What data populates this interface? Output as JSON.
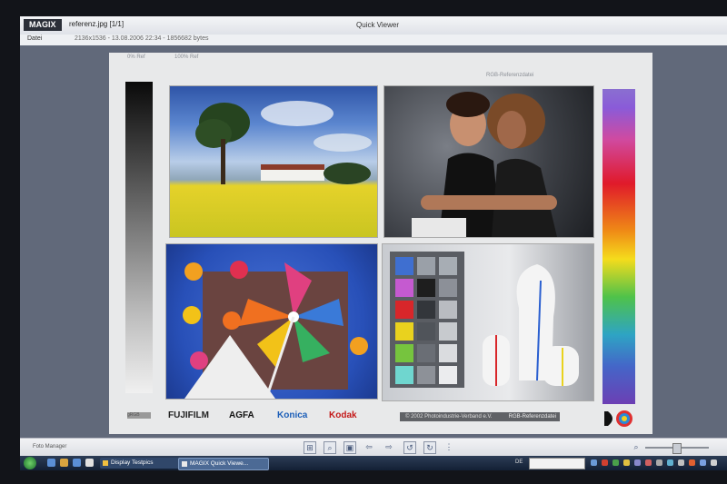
{
  "window": {
    "logo": "MAGIX",
    "filename": "referenz.jpg [1/1]",
    "app_title": "Quick Viewer",
    "menu": [
      "Datei"
    ],
    "file_info": "2136x1536  -  13.08.2006 22:34  -  1856682 bytes"
  },
  "chart_text": {
    "top_left_1": "0% Ref",
    "top_left_2": "100% Ref",
    "top_right": "RGB-Referenzdatei",
    "gray_label": "gRGB",
    "referenz_left": "© 2002 Photoindustrie-Verband e.V.",
    "referenz_right": "RGB-Referenzdatei"
  },
  "brands": {
    "fujifilm": "FUJIFILM",
    "agfa": "AGFA",
    "konica": "Konica",
    "kodak": "Kodak"
  },
  "bottombar": {
    "foto_manager": "Foto Manager"
  },
  "taskbar": {
    "tasks": [
      "Display Testpics",
      "MAGIX Quick Viewe..."
    ],
    "language": "DE"
  },
  "colors": {
    "rainbow": [
      "#8a6fd0",
      "#e01a2a",
      "#ef8a16",
      "#f5dc1c",
      "#4fc24a",
      "#2ea4c4",
      "#4466c8",
      "#6c3fb4"
    ],
    "checker": [
      "#3f6fd0",
      "#9aa0a8",
      "#a7adb4",
      "#c55ad0",
      "#1e1e1e",
      "#8c9098",
      "#d8262a",
      "#33363b",
      "#b9bcc1",
      "#e9d21e",
      "#50545a",
      "#c7cace",
      "#76c43e",
      "#6a6e75",
      "#dadcdf",
      "#6fd6cf",
      "#8d9198",
      "#ebecee"
    ]
  }
}
